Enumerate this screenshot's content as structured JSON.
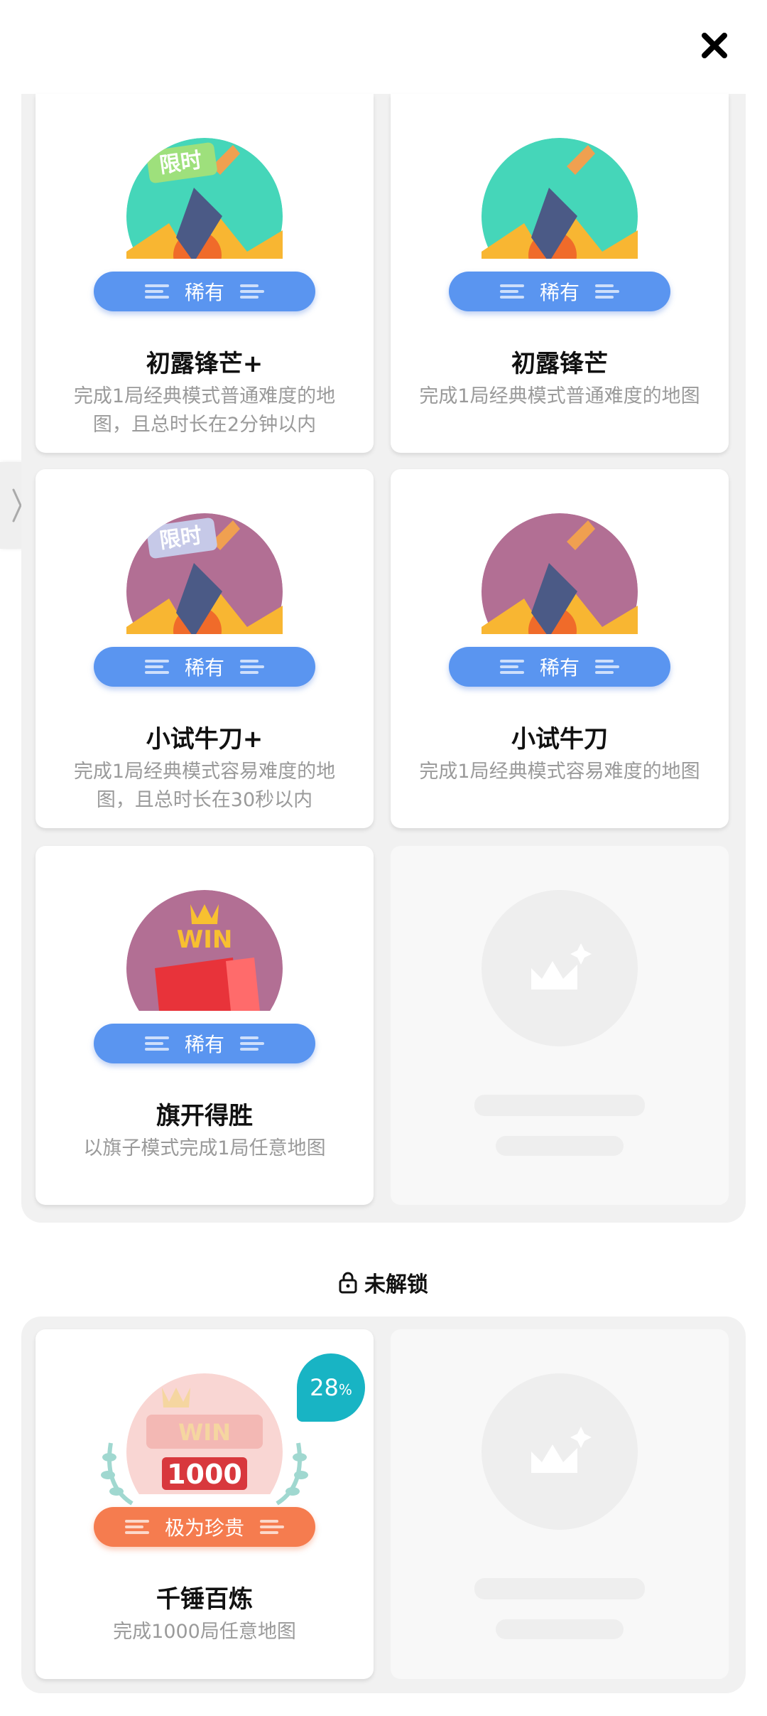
{
  "header": {
    "close_icon": "close-icon"
  },
  "side_tab": {
    "icon": "chevron-right-icon"
  },
  "colors": {
    "rare_pill": "#5a95f0",
    "legendary_pill": "#f57c4f",
    "progress_bubble": "#18b4c4"
  },
  "unlocked": {
    "cards": [
      {
        "title": "初露锋芒+",
        "desc": "完成1局经典模式普通难度的地图，且总时长在2分钟以内",
        "rarity": "稀有",
        "tag": "限时",
        "icon": "shovel-badge-icon"
      },
      {
        "title": "初露锋芒",
        "desc": "完成1局经典模式普通难度的地图",
        "rarity": "稀有",
        "icon": "shovel-badge-icon"
      },
      {
        "title": "小试牛刀+",
        "desc": "完成1局经典模式容易难度的地图，且总时长在30秒以内",
        "rarity": "稀有",
        "tag": "限时",
        "icon": "shovel-badge-icon"
      },
      {
        "title": "小试牛刀",
        "desc": "完成1局经典模式容易难度的地图",
        "rarity": "稀有",
        "icon": "shovel-badge-icon"
      },
      {
        "title": "旗开得胜",
        "desc": "以旗子模式完成1局任意地图",
        "rarity": "稀有",
        "badge_text": "WIN",
        "icon": "flag-badge-icon"
      }
    ]
  },
  "locked_section": {
    "label": "未解锁",
    "icon": "lock-icon",
    "cards": [
      {
        "title": "千锤百炼",
        "desc": "完成1000局任意地图",
        "rarity": "极为珍贵",
        "badge_text": "WIN",
        "badge_number": "1000",
        "progress_value": "28",
        "progress_unit": "%",
        "icon": "laurel-badge-icon"
      }
    ]
  }
}
